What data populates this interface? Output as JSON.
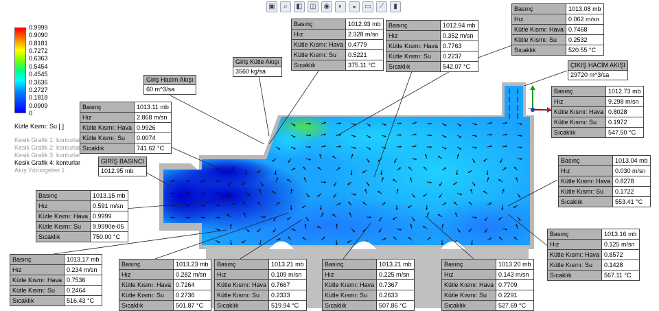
{
  "legend": {
    "ticks": [
      "0.9999",
      "0.9090",
      "0.8181",
      "0.7272",
      "0.6363",
      "0.5454",
      "0.4545",
      "0.3636",
      "0.2727",
      "0.1818",
      "0.0909",
      "0"
    ],
    "title": "Kütle Kısmı: Su [ ]",
    "plots": [
      "Kesik Grafik 1: konturlar",
      "Kesik Grafik 2: konturlar",
      "Kesik Grafik 3: konturlar",
      "Kesik Grafik 4: konturlar",
      "Akış Yörüngeleri 1"
    ],
    "colors": [
      "#ff0000",
      "#ff8000",
      "#ffff00",
      "#80ff00",
      "#00ff80",
      "#00ffff",
      "#0080ff",
      "#0000ff"
    ]
  },
  "toolbar": [
    "view-orient-icon",
    "zoom-fit-icon",
    "section-view-icon",
    "display-style-icon",
    "hide-show-icon",
    "appearance-icon",
    "scene-icon",
    "camera-view-icon",
    "measure-icon",
    "render-icon"
  ],
  "labels": {
    "inlet_mass": {
      "title": "Giriş Kütle Akışı",
      "value": "3560 kg/sa"
    },
    "inlet_volume": {
      "title": "Giriş Hacim Akışı",
      "value": "60 m^3/sa"
    },
    "inlet_pressure": {
      "title": "GİRİŞ BASINCI",
      "value": "1012.95 mb"
    },
    "outlet_volume": {
      "title": "ÇIKIŞ HACİM AKIŞI",
      "value": "29720 m^3/sa"
    }
  },
  "keys": [
    "Basınç",
    "Hız",
    "Kütle Kısmı: Hava",
    "Kütle Kısmı: Su",
    "Sıcaklık"
  ],
  "probes": [
    {
      "id": "p1",
      "values": [
        "1013.11 mb",
        "2.868 m/sn",
        "0.9926",
        "0.0074",
        "741.62 °C"
      ]
    },
    {
      "id": "p2",
      "values": [
        "1012.93 mb",
        "2.328 m/sn",
        "0.4779",
        "0.5221",
        "375.11 °C"
      ]
    },
    {
      "id": "p3",
      "values": [
        "1012.94 mb",
        "0.352 m/sn",
        "0.7763",
        "0.2237",
        "542.07 °C"
      ]
    },
    {
      "id": "p4",
      "values": [
        "1013.08 mb",
        "0.062 m/sn",
        "0.7468",
        "0.2532",
        "520.55 °C"
      ]
    },
    {
      "id": "p5",
      "values": [
        "1012.73 mb",
        "9.298 m/sn",
        "0.8028",
        "0.1972",
        "547.50 °C"
      ]
    },
    {
      "id": "p6",
      "values": [
        "1013.04 mb",
        "0.030 m/sn",
        "0.8278",
        "0.1722",
        "553.41 °C"
      ]
    },
    {
      "id": "p7",
      "values": [
        "1013.15 mb",
        "0.591 m/sn",
        "0.9999",
        "9.9990e-05",
        "750.00 °C"
      ]
    },
    {
      "id": "p8",
      "values": [
        "1013.16 mb",
        "0.125 m/sn",
        "0.8572",
        "0.1428",
        "567.11 °C"
      ]
    },
    {
      "id": "p9",
      "values": [
        "1013.17 mb",
        "0.234 m/sn",
        "0.7536",
        "0.2464",
        "516.43 °C"
      ]
    },
    {
      "id": "p10",
      "values": [
        "1013.23 mb",
        "0.282 m/sn",
        "0.7264",
        "0.2736",
        "501.87 °C"
      ]
    },
    {
      "id": "p11",
      "values": [
        "1013.21 mb",
        "0.109 m/sn",
        "0.7667",
        "0.2333",
        "519.94 °C"
      ]
    },
    {
      "id": "p12",
      "values": [
        "1013.21 mb",
        "0.225 m/sn",
        "0.7367",
        "0.2633",
        "507.86 °C"
      ]
    },
    {
      "id": "p13",
      "values": [
        "1013.20 mb",
        "0.143 m/sn",
        "0.7709",
        "0.2291",
        "527.69 °C"
      ]
    }
  ]
}
